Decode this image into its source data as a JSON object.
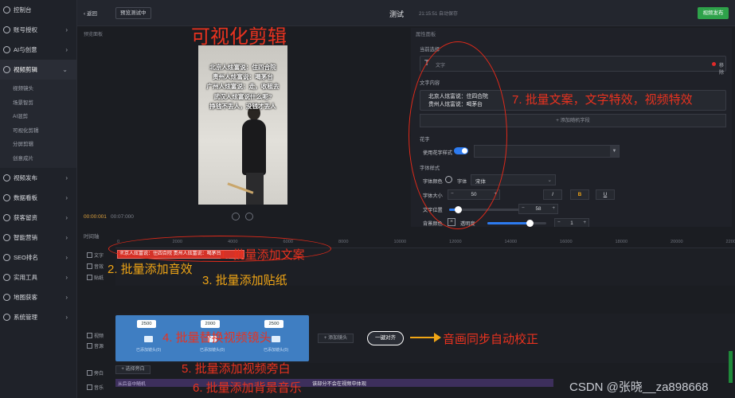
{
  "sidebar": {
    "items": [
      {
        "label": "控制台",
        "icon": "dashboard-icon"
      },
      {
        "label": "账号授权",
        "icon": "account-icon"
      },
      {
        "label": "AI与创意",
        "icon": "ai-icon"
      },
      {
        "label": "视频剪辑",
        "icon": "video-edit-icon"
      },
      {
        "label": "视频发布",
        "icon": "publish-icon"
      },
      {
        "label": "数据看板",
        "icon": "data-icon"
      },
      {
        "label": "获客留资",
        "icon": "leads-icon"
      },
      {
        "label": "智能营销",
        "icon": "marketing-icon"
      },
      {
        "label": "SEO排名",
        "icon": "seo-icon"
      },
      {
        "label": "实用工具",
        "icon": "tools-icon"
      },
      {
        "label": "地图获客",
        "icon": "map-icon"
      },
      {
        "label": "系统管理",
        "icon": "settings-icon"
      }
    ],
    "sub_items": [
      "视频镜头",
      "场景智剪",
      "AI混剪",
      "可视化剪辑",
      "分屏剪辑",
      "创意成片"
    ]
  },
  "topbar": {
    "back": "‹ 返回",
    "preview": "预览测试中",
    "title": "测试",
    "save_status": "21:15:51 自动保存",
    "publish": "视频发布"
  },
  "preview": {
    "label": "预览面板",
    "caption": [
      "北京人炫富说：住四合院",
      "贵州人炫富说：喝茅台",
      "广州人炫富说：走，收租去",
      "武汉人炫富说什么呢?",
      "挣钱不丢人，没钱才丢人"
    ],
    "time_current": "00:00:001",
    "time_total": "00:07:000"
  },
  "props": {
    "panel_label": "属性面板",
    "current_selection": "当前选择",
    "selected_type": "文字",
    "remove": "移除",
    "text_content_label": "文字内容",
    "text_lines": [
      "北京人炫富说：住四合院",
      "贵州人炫富说：喝茅台"
    ],
    "add_field": "+ 添加随机字段",
    "fancy_label": "花字",
    "use_fancy": "使用花字样式",
    "font_style_label": "字体样式",
    "font_color": "字体颜色",
    "font_label": "字体",
    "font_value": "宋体",
    "font_size_label": "字体大小",
    "font_size": "50",
    "italic": "I",
    "bold": "B",
    "underline": "U",
    "text_position": "文字位置",
    "position_value": "58",
    "bg_color": "背景颜色",
    "transparency": "透明度",
    "transparency_value": "1",
    "position_slider_pct": 12,
    "transparency_slider_pct": 72
  },
  "timeline": {
    "label": "时间轴",
    "ticks": [
      "0",
      "2000",
      "4000",
      "6000",
      "8000",
      "10000",
      "12000",
      "14000",
      "16000",
      "18000",
      "20000",
      "22000"
    ],
    "tracks": {
      "text": "文字",
      "audio": "音效",
      "sticker": "贴纸",
      "video": "视频",
      "source": "音源",
      "voiceover": "旁白",
      "music": "音乐"
    },
    "text_clip": "北京人炫富说：住四合院 贵州人炫富说：喝茅台",
    "video_clips": [
      {
        "count": "2500",
        "label": "已添加镜头(0)"
      },
      {
        "count": "2000",
        "label": "已添加镜头(0)"
      },
      {
        "count": "2500",
        "label": "已添加镜头(0)"
      }
    ],
    "add_shot": "+ 添加镜头",
    "align": "一键对齐",
    "voiceover_btn": "+ 选择旁白",
    "music_clip": "从后音中随机",
    "music_tip": "该部分不会在视频中体现"
  },
  "annotations": {
    "big": "可视化剪辑",
    "a1": "1. 批量添加文案",
    "a2": "2. 批量添加音效",
    "a3": "3. 批量添加贴纸",
    "a4": "4. 批量替换视频镜头",
    "a5": "5. 批量添加视频旁白",
    "a6": "6. 批量添加背景音乐",
    "a7": "7. 批量文案，文字特效，视频特效",
    "sync": "音画同步自动校正"
  },
  "watermark": "CSDN @张晓__za898668",
  "colors": {
    "accent": "#e8321f",
    "orange": "#f0a515",
    "publish": "#2ea24a",
    "toggle": "#2d7bf0"
  }
}
